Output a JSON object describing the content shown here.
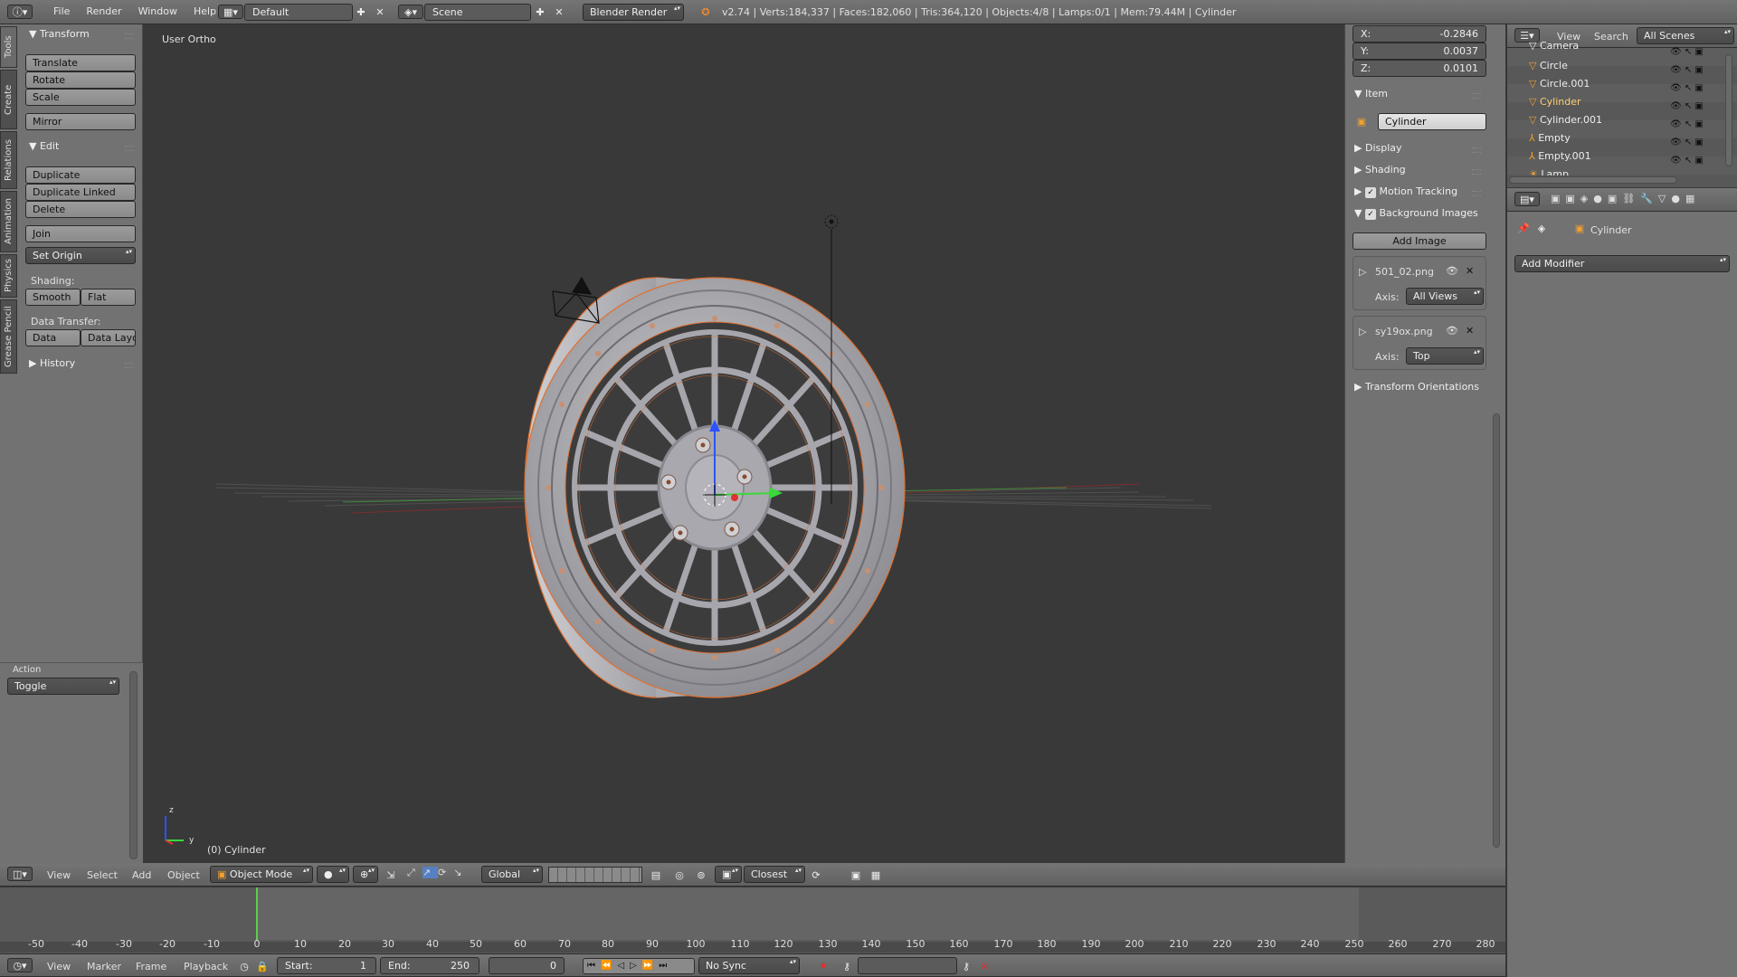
{
  "info_header": {
    "menus": [
      "File",
      "Render",
      "Window",
      "Help"
    ],
    "screen_layout": "Default",
    "scene": "Scene",
    "engine": "Blender Render",
    "stats": "v2.74 | Verts:184,337 | Faces:182,060 | Tris:364,120 | Objects:4/8 | Lamps:0/1 | Mem:79.44M | Cylinder"
  },
  "tool_tabs": [
    "Tools",
    "Create",
    "Relations",
    "Animation",
    "Physics",
    "Grease Pencil"
  ],
  "tool_shelf": {
    "transform_title": "Transform",
    "translate": "Translate",
    "rotate": "Rotate",
    "scale": "Scale",
    "mirror": "Mirror",
    "edit_title": "Edit",
    "duplicate": "Duplicate",
    "duplicate_linked": "Duplicate Linked",
    "delete": "Delete",
    "join": "Join",
    "set_origin": "Set Origin",
    "shading_label": "Shading:",
    "smooth": "Smooth",
    "flat": "Flat",
    "data_transfer_label": "Data Transfer:",
    "data": "Data",
    "data_layo": "Data Layo",
    "history_title": "History",
    "action_label": "Action",
    "action_value": "Toggle"
  },
  "viewport": {
    "view_label": "User Ortho",
    "object_label": "(0) Cylinder",
    "axis_z": "z",
    "axis_y": "y"
  },
  "properties_panel": {
    "x_label": "X:",
    "x_value": "-0.2846",
    "y_label": "Y:",
    "y_value": "0.0037",
    "z_label": "Z:",
    "z_value": "0.0101",
    "item_title": "Item",
    "item_name": "Cylinder",
    "display": "Display",
    "shading": "Shading",
    "motion_tracking": "Motion Tracking",
    "background_images": "Background Images",
    "add_image": "Add Image",
    "image1": "501_02.png",
    "axis_label": "Axis:",
    "image1_axis": "All Views",
    "image2": "sy19ox.png",
    "image2_axis": "Top",
    "transform_orientations": "Transform Orientations"
  },
  "outliner": {
    "menus": [
      "View",
      "Search"
    ],
    "scene_filter": "All Scenes",
    "items": [
      "Camera",
      "Circle",
      "Circle.001",
      "Cylinder",
      "Cylinder.001",
      "Empty",
      "Empty.001",
      "Lamp"
    ]
  },
  "properties_editor": {
    "breadcrumb": "Cylinder",
    "add_modifier": "Add Modifier"
  },
  "view3d_header": {
    "menus": [
      "View",
      "Select",
      "Add",
      "Object"
    ],
    "mode": "Object Mode",
    "orientation": "Global",
    "snap": "Closest"
  },
  "timeline": {
    "ticks": [
      "-50",
      "-40",
      "-30",
      "-20",
      "-10",
      "0",
      "10",
      "20",
      "30",
      "40",
      "50",
      "60",
      "70",
      "80",
      "90",
      "100",
      "110",
      "120",
      "130",
      "140",
      "150",
      "160",
      "170",
      "180",
      "190",
      "200",
      "210",
      "220",
      "230",
      "240",
      "250",
      "260",
      "270",
      "280"
    ],
    "menus": [
      "View",
      "Marker",
      "Frame",
      "Playback"
    ],
    "start_label": "Start:",
    "start_value": "1",
    "end_label": "End:",
    "end_value": "250",
    "current": "0",
    "sync": "No Sync"
  },
  "colors": {
    "background": "#393939",
    "panel": "#727272",
    "header": "#686868",
    "selection_orange": "#e07030",
    "text": "#e0e0e0"
  }
}
